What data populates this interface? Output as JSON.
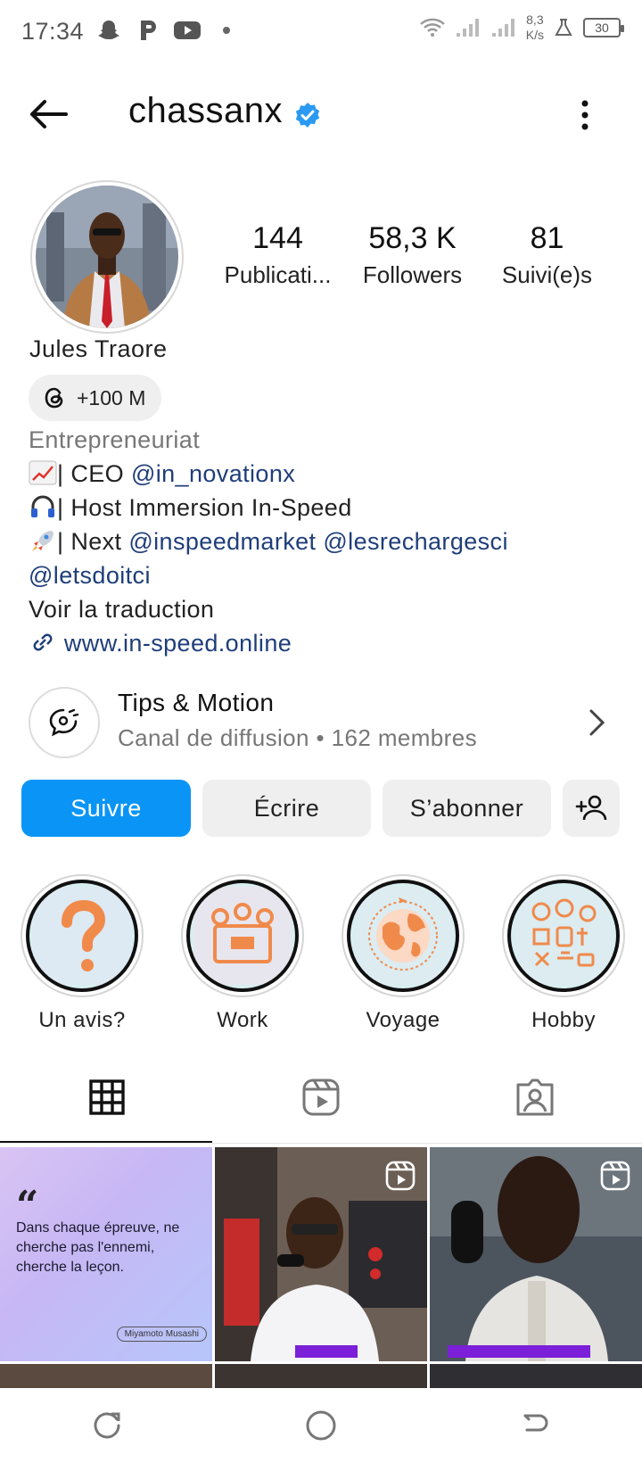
{
  "status_bar": {
    "time": "17:34",
    "net_speed_value": "8,3",
    "net_speed_unit": "K/s",
    "battery": "30",
    "icons_left": [
      "snapchat-icon",
      "p-app-icon",
      "youtube-icon",
      "dot-icon"
    ],
    "icons_right": [
      "wifi-icon",
      "signal-icon",
      "signal-icon",
      "flask-icon",
      "battery-icon"
    ]
  },
  "header": {
    "username": "chassanx",
    "verified": true,
    "back_icon": "arrow-left-icon",
    "more_icon": "more-vertical-icon"
  },
  "profile": {
    "stats": [
      {
        "value": "144",
        "label": "Publicati..."
      },
      {
        "value": "58,3 K",
        "label": "Followers"
      },
      {
        "value": "81",
        "label": "Suivi(e)s"
      }
    ],
    "full_name": "Jules Traore",
    "threads_count": "+100 M",
    "bio": {
      "category": "Entrepreneuriat",
      "line1_text": "| CEO ",
      "line1_mention": "@in_novationx",
      "line2_text": "| Host Immersion In-Speed",
      "line3_text": "| Next ",
      "line3_mention1": "@inspeedmarket",
      "line3_mention2": "@lesrechargesci",
      "line4_mention": "@letsdoitci",
      "translate": "Voir la traduction",
      "website": "www.in-speed.online"
    }
  },
  "channel": {
    "title": "Tips & Motion",
    "subtitle": "Canal de diffusion • 162 membres"
  },
  "actions": {
    "follow": "Suivre",
    "write": "Écrire",
    "subscribe": "S’abonner"
  },
  "highlights": [
    {
      "label": "Un avis?"
    },
    {
      "label": "Work"
    },
    {
      "label": "Voyage"
    },
    {
      "label": "Hobby"
    }
  ],
  "tabs": [
    "grid-icon",
    "reels-icon",
    "tagged-icon"
  ],
  "posts": {
    "quote_text": "Dans chaque épreuve, ne cherche pas l'ennemi, cherche la leçon.",
    "quote_author": "Miyamoto Musashi"
  },
  "colors": {
    "accent": "#0a95f6",
    "link": "#1f3e7a",
    "secondary_text": "#777777",
    "button_grey": "#efefef"
  }
}
